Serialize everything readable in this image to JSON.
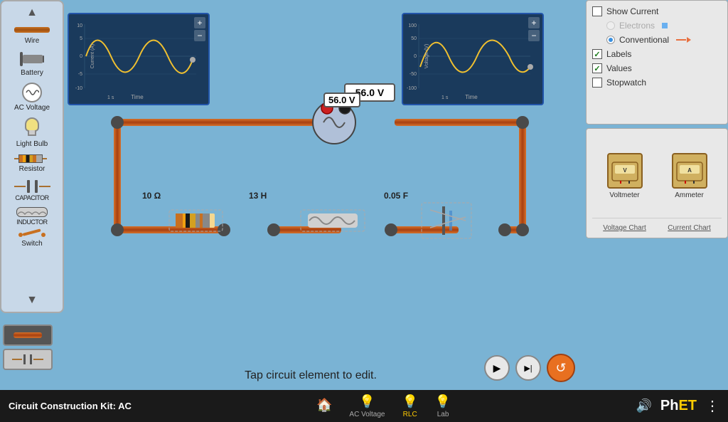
{
  "sidebar": {
    "up_arrow": "▲",
    "down_arrow": "▼",
    "items": [
      {
        "id": "wire",
        "label": "Wire"
      },
      {
        "id": "battery",
        "label": "Battery"
      },
      {
        "id": "ac-voltage",
        "label": "AC Voltage"
      },
      {
        "id": "light-bulb",
        "label": "Light Bulb"
      },
      {
        "id": "resistor",
        "label": "Resistor"
      },
      {
        "id": "capacitor",
        "label": "Capacitor"
      },
      {
        "id": "inductor",
        "label": "Inductor"
      },
      {
        "id": "switch",
        "label": "Switch"
      }
    ]
  },
  "controls": {
    "show_current": {
      "label": "Show Current",
      "checked": false
    },
    "electrons": {
      "label": "Electrons",
      "checked": false,
      "disabled": true
    },
    "conventional": {
      "label": "Conventional",
      "checked": false,
      "disabled": true
    },
    "labels": {
      "label": "Labels",
      "checked": true
    },
    "values": {
      "label": "Values",
      "checked": true
    },
    "stopwatch": {
      "label": "Stopwatch",
      "checked": false
    }
  },
  "instruments": {
    "voltmeter": {
      "label": "Voltmeter"
    },
    "ammeter": {
      "label": "Ammeter"
    },
    "voltage_chart": {
      "label": "Voltage Chart"
    },
    "current_chart": {
      "label": "Current Chart"
    }
  },
  "graphs": {
    "current": {
      "title": "Current (A)",
      "x_label": "Time",
      "x_unit": "1 s"
    },
    "voltage": {
      "title": "Voltage (V)",
      "x_label": "Time",
      "x_unit": "1 s"
    }
  },
  "circuit": {
    "voltmeter_reading": "56.0 V",
    "resistor_value": "10 Ω",
    "inductor_value": "13 H",
    "capacitor_value": "0.05 F"
  },
  "status_bar": {
    "title": "Circuit Construction Kit: AC",
    "nav_items": [
      {
        "id": "home",
        "icon": "🏠",
        "label": ""
      },
      {
        "id": "ac-voltage",
        "icon": "💡",
        "label": "AC Voltage"
      },
      {
        "id": "rlc",
        "icon": "💡",
        "label": "RLC",
        "active": true
      },
      {
        "id": "lab",
        "icon": "💡",
        "label": "Lab"
      }
    ],
    "sound_icon": "🔊",
    "phet_label": "PhET",
    "menu_icon": "⋮"
  },
  "play_controls": {
    "play": "▶",
    "step": "▶|",
    "reload": "↺"
  },
  "status_message": "Tap circuit element to edit."
}
